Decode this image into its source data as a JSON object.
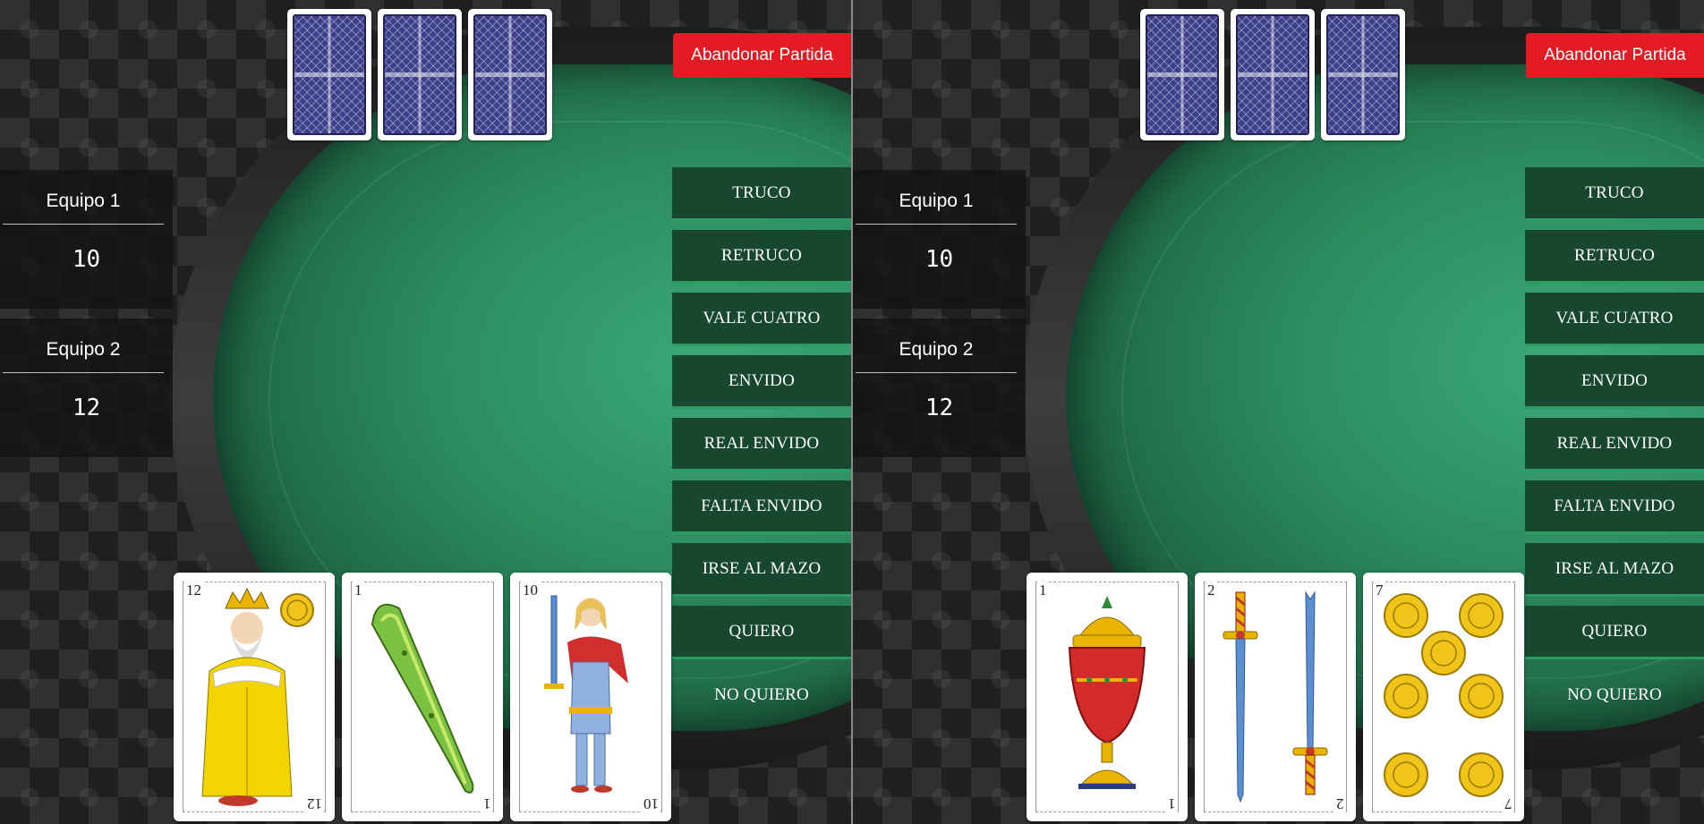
{
  "header": {
    "abandon_label": "Abandonar Partida"
  },
  "scoreboard": [
    {
      "team": "Equipo 1",
      "points": "10"
    },
    {
      "team": "Equipo 2",
      "points": "12"
    }
  ],
  "actions": [
    "TRUCO",
    "RETRUCO",
    "VALE CUATRO",
    "ENVIDO",
    "REAL ENVIDO",
    "FALTA ENVIDO",
    "IRSE AL MAZO",
    "QUIERO",
    "NO QUIERO"
  ],
  "views": [
    {
      "hand": [
        {
          "number": "12",
          "suit": "oros",
          "figure": "rey"
        },
        {
          "number": "1",
          "suit": "bastos",
          "figure": "as"
        },
        {
          "number": "10",
          "suit": "espadas",
          "figure": "sota"
        }
      ]
    },
    {
      "hand": [
        {
          "number": "1",
          "suit": "copas",
          "figure": "as"
        },
        {
          "number": "2",
          "suit": "espadas",
          "figure": "dos"
        },
        {
          "number": "7",
          "suit": "oros",
          "figure": "siete"
        }
      ]
    }
  ],
  "icons": {
    "card_back": "card-back-pattern-icon"
  },
  "colors": {
    "abandon": "#e51b24",
    "action_bg": "#17472f",
    "felt": "#2b8b5e",
    "card_back": "#3c3f8a"
  }
}
